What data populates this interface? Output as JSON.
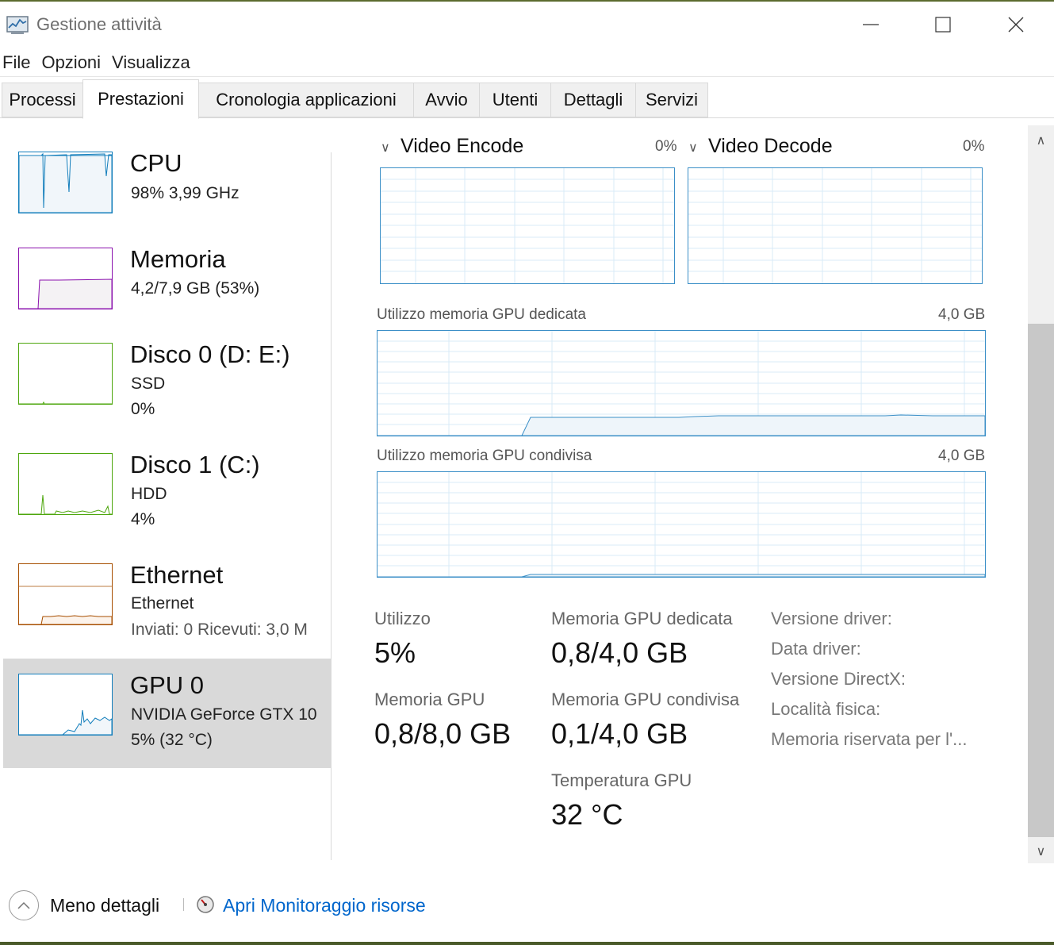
{
  "window": {
    "title": "Gestione attività",
    "icon": "task-manager-icon",
    "controls": [
      "minimize-icon",
      "maximize-icon",
      "close-icon"
    ]
  },
  "menu": [
    "File",
    "Opzioni",
    "Visualizza"
  ],
  "tabs": [
    {
      "label": "Processi",
      "active": false
    },
    {
      "label": "Prestazioni",
      "active": true
    },
    {
      "label": "Cronologia applicazioni",
      "active": false
    },
    {
      "label": "Avvio",
      "active": false
    },
    {
      "label": "Utenti",
      "active": false
    },
    {
      "label": "Dettagli",
      "active": false
    },
    {
      "label": "Servizi",
      "active": false
    }
  ],
  "devices": {
    "cpu": {
      "name": "CPU",
      "detail": "98%  3,99 GHz",
      "color": "#117dbb"
    },
    "memory": {
      "name": "Memoria",
      "detail": "4,2/7,9 GB (53%)",
      "color": "#8b12ae"
    },
    "disk0": {
      "name": "Disco 0 (D: E:)",
      "type": "SSD",
      "usage": "0%",
      "color": "#4da60c"
    },
    "disk1": {
      "name": "Disco 1 (C:)",
      "type": "HDD",
      "usage": "4%",
      "color": "#4da60c"
    },
    "ethernet": {
      "name": "Ethernet",
      "sub": "Ethernet",
      "traffic": "Inviati: 0  Ricevuti: 3,0 M",
      "color": "#a74f01"
    },
    "gpu": {
      "name": "GPU 0",
      "model": "NVIDIA GeForce GTX 10",
      "usage": "5%  (32 °C)",
      "color": "#117dbb",
      "selected": true
    }
  },
  "gpu_panel": {
    "video_encode": {
      "label": "Video Encode",
      "value": "0%"
    },
    "video_decode": {
      "label": "Video Decode",
      "value": "0%"
    },
    "dedicated_graph": {
      "label": "Utilizzo memoria GPU dedicata",
      "max": "4,0 GB"
    },
    "shared_graph": {
      "label": "Utilizzo memoria GPU condivisa",
      "max": "4,0 GB"
    },
    "stats": {
      "utilization_label": "Utilizzo",
      "utilization_value": "5%",
      "gpu_memory_label": "Memoria GPU",
      "gpu_memory_value": "0,8/8,0 GB",
      "dedicated_label": "Memoria GPU dedicata",
      "dedicated_value": "0,8/4,0 GB",
      "shared_label": "Memoria GPU condivisa",
      "shared_value": "0,1/4,0 GB",
      "temp_label": "Temperatura GPU",
      "temp_value": "32 °C"
    },
    "info": {
      "driver_version": "Versione driver:",
      "driver_date": "Data driver:",
      "directx_version": "Versione DirectX:",
      "physical_location": "Località fisica:",
      "reserved_memory": "Memoria riservata per l'..."
    }
  },
  "footer": {
    "less_details": "Meno dettagli",
    "resource_monitor": "Apri Monitoraggio risorse",
    "link_color": "#0066cc"
  }
}
